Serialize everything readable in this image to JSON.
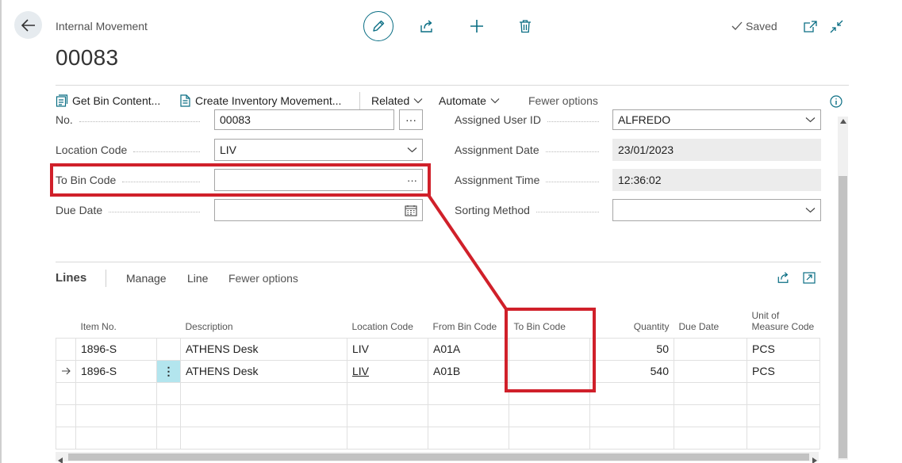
{
  "header": {
    "caption": "Internal Movement",
    "title": "00083",
    "saved_label": "Saved"
  },
  "actions": {
    "get_bin_content": "Get Bin Content...",
    "create_inventory_movement": "Create Inventory Movement...",
    "related": "Related",
    "automate": "Automate",
    "fewer_options": "Fewer options"
  },
  "form": {
    "no_label": "No.",
    "no_value": "00083",
    "location_label": "Location Code",
    "location_value": "LIV",
    "to_bin_label": "To Bin Code",
    "to_bin_value": "",
    "due_date_label": "Due Date",
    "due_date_value": "",
    "assigned_user_label": "Assigned User ID",
    "assigned_user_value": "ALFREDO",
    "assignment_date_label": "Assignment Date",
    "assignment_date_value": "23/01/2023",
    "assignment_time_label": "Assignment Time",
    "assignment_time_value": "12:36:02",
    "sorting_label": "Sorting Method",
    "sorting_value": ""
  },
  "lines": {
    "title": "Lines",
    "manage": "Manage",
    "line": "Line",
    "fewer_options": "Fewer options",
    "columns": {
      "item_no": "Item No.",
      "description": "Description",
      "location_code": "Location Code",
      "from_bin": "From Bin Code",
      "to_bin": "To Bin Code",
      "quantity": "Quantity",
      "due_date": "Due Date",
      "uom": "Unit of Measure Code"
    },
    "rows": [
      {
        "item_no": "1896-S",
        "description": "ATHENS Desk",
        "location": "LIV",
        "from_bin": "A01A",
        "to_bin": "",
        "quantity": "50",
        "due_date": "",
        "uom": "PCS"
      },
      {
        "item_no": "1896-S",
        "description": "ATHENS Desk",
        "location": "LIV",
        "from_bin": "A01B",
        "to_bin": "",
        "quantity": "540",
        "due_date": "",
        "uom": "PCS"
      }
    ]
  },
  "colors": {
    "accent": "#0a6e84",
    "highlight": "#d0202a",
    "selected_cell": "#b3e5ee"
  }
}
